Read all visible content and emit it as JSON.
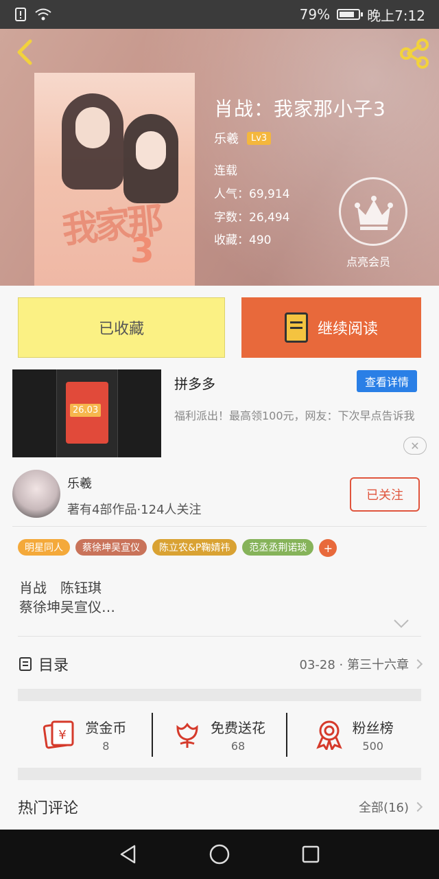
{
  "status_bar": {
    "battery": "79%",
    "time": "晚上7:12",
    "battery_level": 0.79
  },
  "book": {
    "title": "肖战：我家那小子3",
    "author": "乐羲",
    "level_badge": "Lv3",
    "status": "连载",
    "popularity": "人气：69,914",
    "words": "字数：26,494",
    "favorites": "收藏：490",
    "vip_label": "点亮会员"
  },
  "actions": {
    "favorited": "已收藏",
    "continue_reading": "继续阅读"
  },
  "ad": {
    "title": "拼多多",
    "detail_button": "查看详情",
    "description": "福利派出！最高领100元，网友：下次早点告诉我",
    "close": "✕",
    "amount": "26.03"
  },
  "author_section": {
    "name": "乐羲",
    "stats": "著有4部作品·124人关注",
    "follow_button": "已关注"
  },
  "tags": [
    {
      "label": "明星同人",
      "color": "#f4a93a"
    },
    {
      "label": "蔡徐坤吴宣仪",
      "color": "#c9735a"
    },
    {
      "label": "陈立农&P鞠婧祎",
      "color": "#d9a233"
    },
    {
      "label": "范丞丞荆诺琰",
      "color": "#86b35a"
    }
  ],
  "tag_add": "+",
  "description": {
    "line1": "肖战　陈钰琪",
    "line2": "蔡徐坤吴宣仪…"
  },
  "catalog": {
    "label": "目录",
    "latest": "03-28 · 第三十六章"
  },
  "stats": [
    {
      "label": "赏金币",
      "value": "8"
    },
    {
      "label": "免费送花",
      "value": "68"
    },
    {
      "label": "粉丝榜",
      "value": "500"
    }
  ],
  "comments": {
    "title": "热门评论",
    "all": "全部(16)"
  },
  "colors": {
    "accent": "#e8693b",
    "fav_yellow": "#fbf184",
    "ad_blue": "#2a7fe6",
    "follow_red": "#e0553d"
  }
}
